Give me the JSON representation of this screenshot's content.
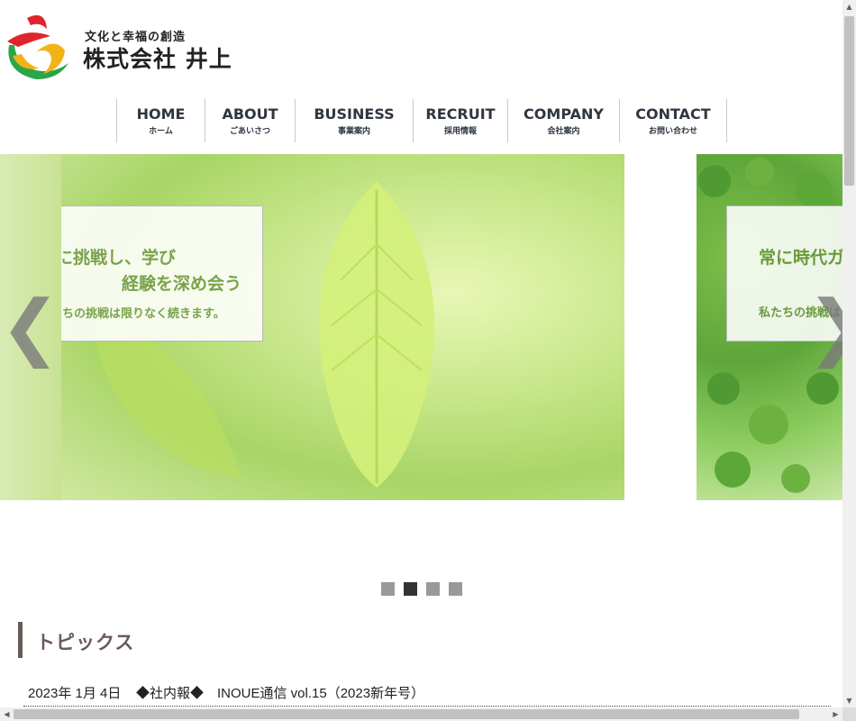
{
  "header": {
    "tagline": "文化と幸福の創造",
    "company_name": "株式会社 井上"
  },
  "nav": [
    {
      "label": "HOME",
      "sub": "ホーム"
    },
    {
      "label": "ABOUT",
      "sub": "ごあいさつ"
    },
    {
      "label": "BUSINESS",
      "sub": "事業案内"
    },
    {
      "label": "RECRUIT",
      "sub": "採用情報"
    },
    {
      "label": "COMPANY",
      "sub": "会社案内"
    },
    {
      "label": "CONTACT",
      "sub": "お問い合わせ"
    }
  ],
  "slider": {
    "main_caption": {
      "line1": "常に挑戦し、学び",
      "line2": "経験を深め会う",
      "line3": "私たちの挑戦は限りなく続きます。"
    },
    "next_caption": {
      "line1": "常に時代ガ",
      "line3": "私たちの挑戦は"
    },
    "prev_arrow": "❮",
    "next_arrow": "❯",
    "active_slide": 2,
    "slide_count": 4
  },
  "topics": {
    "title": "トピックス",
    "items": [
      {
        "date": "2023年 1月 4日",
        "text": "◆社内報◆　INOUE通信 vol.15（2023新年号）"
      }
    ]
  },
  "scrollbar": {
    "up": "▲",
    "down": "▼",
    "left": "◀",
    "right": "▶"
  }
}
